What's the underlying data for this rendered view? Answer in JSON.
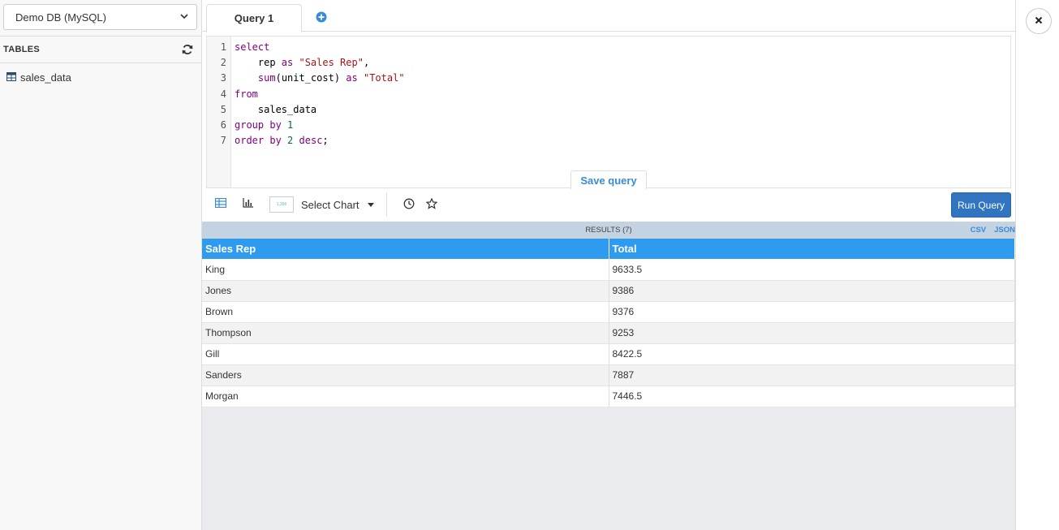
{
  "sidebar": {
    "db_select": {
      "value": "Demo DB (MySQL)"
    },
    "tables_label": "TABLES",
    "tables": [
      {
        "label": "sales_data"
      }
    ]
  },
  "tabs": [
    {
      "label": "Query 1"
    }
  ],
  "editor": {
    "line_numbers": [
      "1",
      "2",
      "3",
      "4",
      "5",
      "6",
      "7"
    ],
    "lines": [
      "select",
      "    rep as \"Sales Rep\",",
      "    sum(unit_cost) as \"Total\"",
      "from",
      "    sales_data",
      "group by 1",
      "order by 2 desc;"
    ],
    "save_label": "Save query"
  },
  "toolbar": {
    "thumb_text": "1,396",
    "chart_select_label": "Select Chart",
    "run_label": "Run Query"
  },
  "results": {
    "label": "RESULTS (7)",
    "csv_label": "CSV",
    "json_label": "JSON",
    "columns": [
      "Sales Rep",
      "Total"
    ],
    "rows": [
      [
        "King",
        "9633.5"
      ],
      [
        "Jones",
        "9386"
      ],
      [
        "Brown",
        "9376"
      ],
      [
        "Thompson",
        "9253"
      ],
      [
        "Gill",
        "8422.5"
      ],
      [
        "Sanders",
        "7887"
      ],
      [
        "Morgan",
        "7446.5"
      ]
    ]
  },
  "colors": {
    "accent": "#2f9bef",
    "run_button": "#3175c0",
    "results_bar": "#c4d3e2"
  }
}
